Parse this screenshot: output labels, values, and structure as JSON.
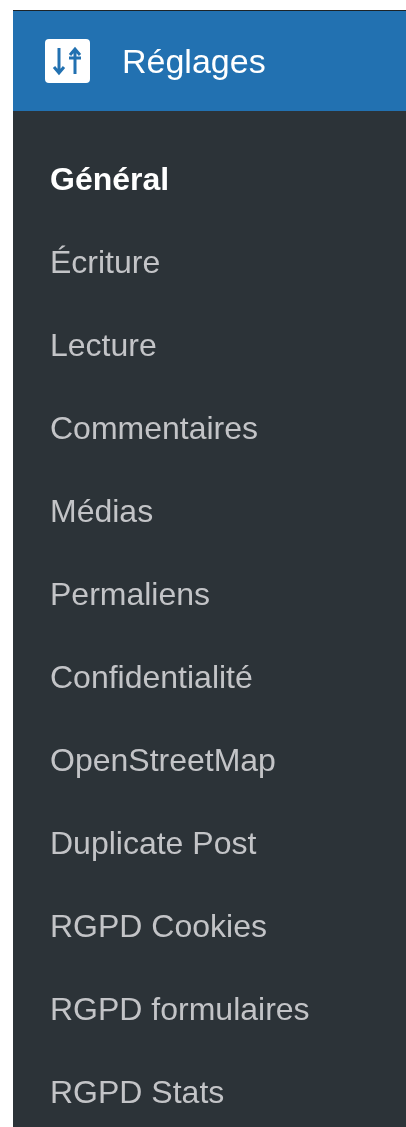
{
  "menu": {
    "title": "Réglages"
  },
  "items": [
    {
      "label": "Général",
      "selected": true
    },
    {
      "label": "Écriture",
      "selected": false
    },
    {
      "label": "Lecture",
      "selected": false
    },
    {
      "label": "Commentaires",
      "selected": false
    },
    {
      "label": "Médias",
      "selected": false
    },
    {
      "label": "Permaliens",
      "selected": false
    },
    {
      "label": "Confidentialité",
      "selected": false
    },
    {
      "label": "OpenStreetMap",
      "selected": false
    },
    {
      "label": "Duplicate Post",
      "selected": false
    },
    {
      "label": "RGPD Cookies",
      "selected": false
    },
    {
      "label": "RGPD formulaires",
      "selected": false
    },
    {
      "label": "RGPD Stats",
      "selected": false
    }
  ]
}
